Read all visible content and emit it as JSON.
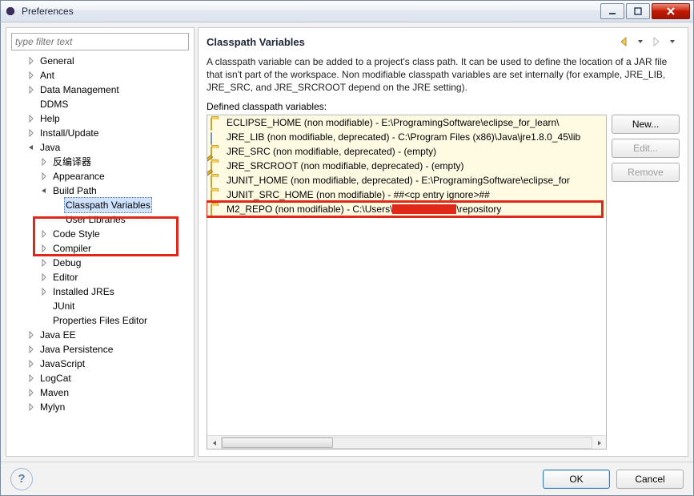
{
  "window": {
    "title": "Preferences"
  },
  "filter": {
    "placeholder": "type filter text"
  },
  "tree": [
    {
      "label": "General",
      "indent": 1,
      "twisty": "closed"
    },
    {
      "label": "Ant",
      "indent": 1,
      "twisty": "closed"
    },
    {
      "label": "Data Management",
      "indent": 1,
      "twisty": "closed"
    },
    {
      "label": "DDMS",
      "indent": 1,
      "twisty": "none"
    },
    {
      "label": "Help",
      "indent": 1,
      "twisty": "closed"
    },
    {
      "label": "Install/Update",
      "indent": 1,
      "twisty": "closed"
    },
    {
      "label": "Java",
      "indent": 1,
      "twisty": "open"
    },
    {
      "label": "反编译器",
      "indent": 2,
      "twisty": "closed"
    },
    {
      "label": "Appearance",
      "indent": 2,
      "twisty": "closed"
    },
    {
      "label": "Build Path",
      "indent": 2,
      "twisty": "open"
    },
    {
      "label": "Classpath Variables",
      "indent": 3,
      "twisty": "none",
      "selected": true
    },
    {
      "label": "User Libraries",
      "indent": 3,
      "twisty": "none"
    },
    {
      "label": "Code Style",
      "indent": 2,
      "twisty": "closed"
    },
    {
      "label": "Compiler",
      "indent": 2,
      "twisty": "closed"
    },
    {
      "label": "Debug",
      "indent": 2,
      "twisty": "closed"
    },
    {
      "label": "Editor",
      "indent": 2,
      "twisty": "closed"
    },
    {
      "label": "Installed JREs",
      "indent": 2,
      "twisty": "closed"
    },
    {
      "label": "JUnit",
      "indent": 2,
      "twisty": "none"
    },
    {
      "label": "Properties Files Editor",
      "indent": 2,
      "twisty": "none"
    },
    {
      "label": "Java EE",
      "indent": 1,
      "twisty": "closed"
    },
    {
      "label": "Java Persistence",
      "indent": 1,
      "twisty": "closed"
    },
    {
      "label": "JavaScript",
      "indent": 1,
      "twisty": "closed"
    },
    {
      "label": "LogCat",
      "indent": 1,
      "twisty": "closed"
    },
    {
      "label": "Maven",
      "indent": 1,
      "twisty": "closed"
    },
    {
      "label": "Mylyn",
      "indent": 1,
      "twisty": "closed"
    }
  ],
  "page": {
    "heading": "Classpath Variables",
    "description": "A classpath variable can be added to a project's class path. It can be used to define the location of a JAR file that isn't part of the workspace. Non modifiable classpath variables are set internally (for example, JRE_LIB, JRE_SRC, and JRE_SRCROOT depend on the JRE setting).",
    "listLabel": "Defined classpath variables:",
    "vars": [
      {
        "icon": "folder",
        "text": "ECLIPSE_HOME (non modifiable) - E:\\ProgramingSoftware\\eclipse_for_learn\\"
      },
      {
        "icon": "jar",
        "text": "JRE_LIB (non modifiable, deprecated) - C:\\Program Files (x86)\\Java\\jre1.8.0_45\\lib"
      },
      {
        "icon": "folder-pencil",
        "text": "JRE_SRC (non modifiable, deprecated) - (empty)"
      },
      {
        "icon": "folder-pencil",
        "text": "JRE_SRCROOT (non modifiable, deprecated) - (empty)"
      },
      {
        "icon": "folder",
        "text": "JUNIT_HOME (non modifiable, deprecated) - E:\\ProgramingSoftware\\eclipse_for"
      },
      {
        "icon": "folder",
        "text": "JUNIT_SRC_HOME (non modifiable) - ##<cp entry ignore>##"
      },
      {
        "icon": "folder",
        "text_pre": "M2_REPO (non modifiable) - C:\\Users\\",
        "text_post": "\\repository",
        "censored": true
      }
    ],
    "buttons": {
      "new": "New...",
      "edit": "Edit...",
      "remove": "Remove"
    }
  },
  "footer": {
    "ok": "OK",
    "cancel": "Cancel"
  }
}
